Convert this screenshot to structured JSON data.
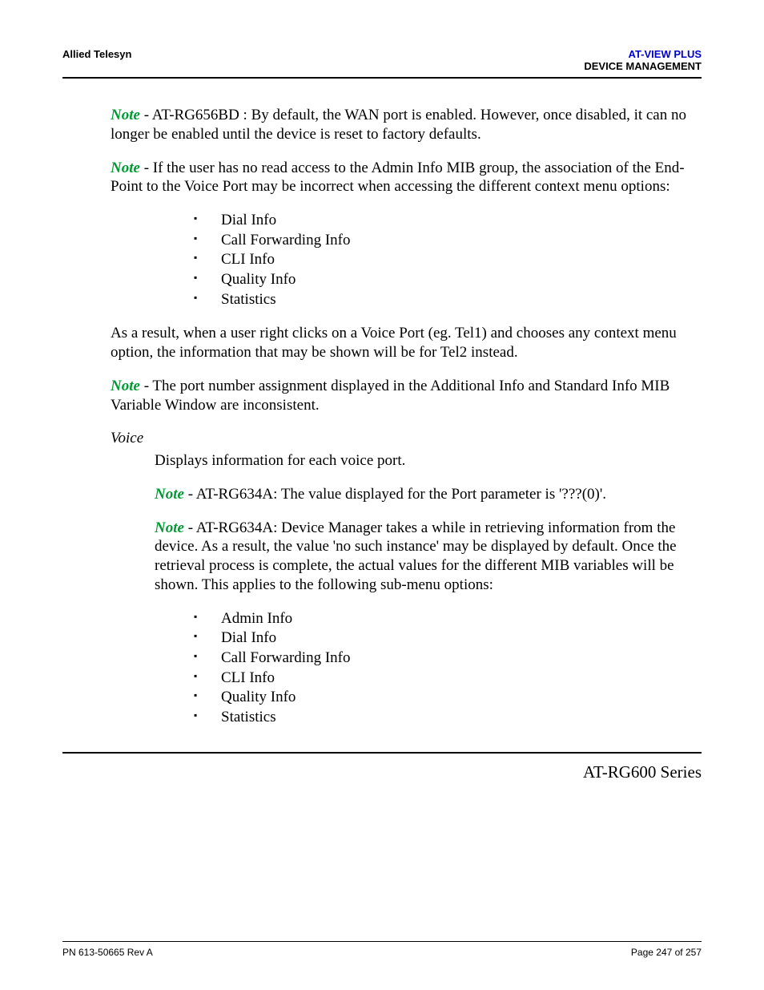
{
  "header": {
    "left": "Allied Telesyn",
    "rightProduct": "AT-VIEW PLUS",
    "rightSection": "DEVICE MANAGEMENT"
  },
  "notes": {
    "label": "Note",
    "note1": " - AT-RG656BD : By default, the WAN port is enabled. However, once disabled, it can no longer be enabled until the device is reset to factory defaults.",
    "note2": " - If the user has no read access to the Admin Info MIB group, the association of the End-Point to the Voice Port may be incorrect when accessing the different context menu options:",
    "note3": " - The port number assignment displayed in the Additional Info and Standard Info MIB Variable Window are inconsistent.",
    "note4": " - AT-RG634A: The value displayed for the Port parameter is '???(0)'.",
    "note5": " - AT-RG634A: Device Manager takes a while in retrieving information from the device. As a result, the value 'no such instance' may be displayed by default. Once the retrieval process is complete, the actual values for the different MIB variables will be shown. This applies to the following sub-menu options:"
  },
  "bulletList1": {
    "i0": "Dial Info",
    "i1": "Call Forwarding Info",
    "i2": "CLI Info",
    "i3": "Quality Info",
    "i4": "Statistics"
  },
  "paraAfterList1": "As a result, when a user right clicks on a Voice Port (eg. Tel1) and chooses any context menu option, the information that may be shown will be for Tel2 instead.",
  "voice": {
    "heading": "Voice",
    "desc": "Displays information for each voice port."
  },
  "bulletList2": {
    "i0": "Admin Info",
    "i1": "Dial Info",
    "i2": "Call Forwarding Info",
    "i3": "CLI Info",
    "i4": "Quality Info",
    "i5": "Statistics"
  },
  "seriesTitle": "AT-RG600 Series",
  "footer": {
    "left": "PN 613-50665 Rev A",
    "right": "Page 247 of 257"
  }
}
